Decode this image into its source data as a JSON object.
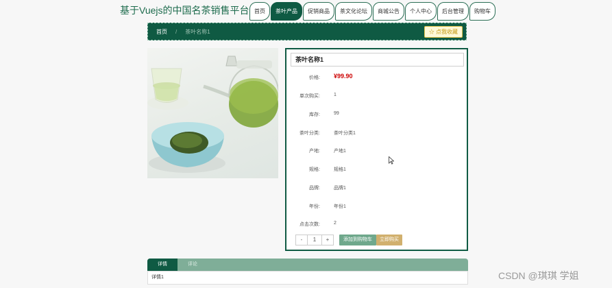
{
  "header": {
    "site_title": "基于Vuejs的中国名茶销售平台",
    "nav": [
      "首页",
      "茶叶产品",
      "促销商品",
      "茶文化论坛",
      "商城公告",
      "个人中心",
      "后台管理",
      "购物车"
    ]
  },
  "breadcrumb": {
    "home": "首页",
    "separator": "/",
    "current": "茶叶名称1",
    "favorite_button": "☆ 点我收藏"
  },
  "product": {
    "title": "茶叶名称1",
    "attributes": [
      {
        "label": "价格:",
        "value": "¥99.90"
      },
      {
        "label": "单次购买:",
        "value": "1"
      },
      {
        "label": "库存:",
        "value": "99"
      },
      {
        "label": "茶叶分类:",
        "value": "茶叶分类1"
      },
      {
        "label": "产地:",
        "value": "产地1"
      },
      {
        "label": "规格:",
        "value": "规格1"
      },
      {
        "label": "品牌:",
        "value": "品牌1"
      },
      {
        "label": "年份:",
        "value": "年份1"
      },
      {
        "label": "点击次数:",
        "value": "2"
      }
    ],
    "quantity": {
      "minus": "-",
      "value": "1",
      "plus": "+"
    },
    "add_to_cart": "添加到购物车",
    "buy_now": "立即购买"
  },
  "detail": {
    "tabs": [
      "详情",
      "评论"
    ],
    "content": "详情1"
  },
  "watermark": "CSDN @琪琪 学姐",
  "colors": {
    "primary": "#0f5a43",
    "price": "#cc0000",
    "cart_button": "#6fa88c",
    "buy_button": "#d1b06e"
  }
}
